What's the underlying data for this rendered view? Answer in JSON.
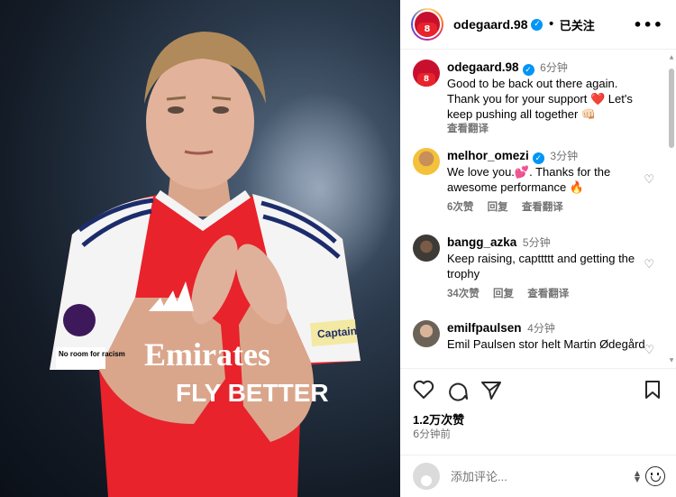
{
  "photo": {
    "sleeve_badge_text": "No room for racism",
    "armband_text": "Captain",
    "sponsor_line1": "Emirates",
    "sponsor_line2": "FLY BETTER"
  },
  "header": {
    "username": "odegaard.98",
    "separator": "•",
    "follow_label": "已关注",
    "more_icon": "more-horizontal-icon"
  },
  "caption": {
    "username": "odegaard.98",
    "time": "6分钟",
    "text": "Good to be back out there again. Thank you for your support ❤️ Let's keep pushing all together 👊🏻",
    "translate_label": "查看翻译"
  },
  "comments": [
    {
      "username": "melhor_omezi",
      "verified": true,
      "time": "3分钟",
      "text": "We love you.💕. Thanks for the awesome performance 🔥",
      "likes": "6次赞",
      "reply": "回复",
      "translate": "查看翻译"
    },
    {
      "username": "bangg_azka",
      "verified": false,
      "time": "5分钟",
      "text": "Keep raising, capttttt and getting the trophy",
      "likes": "34次赞",
      "reply": "回复",
      "translate": "查看翻译"
    },
    {
      "username": "emilfpaulsen",
      "verified": false,
      "time": "4分钟",
      "text": "Emil Paulsen stor helt Martin Ødegård",
      "likes": "",
      "reply": "",
      "translate": ""
    }
  ],
  "actions": {
    "likes_count": "1.2万次赞",
    "posted_time": "6分钟前"
  },
  "compose": {
    "placeholder": "添加评论..."
  },
  "colors": {
    "verified": "#0095f6",
    "heart": "#ed4956",
    "muted": "#737373"
  }
}
